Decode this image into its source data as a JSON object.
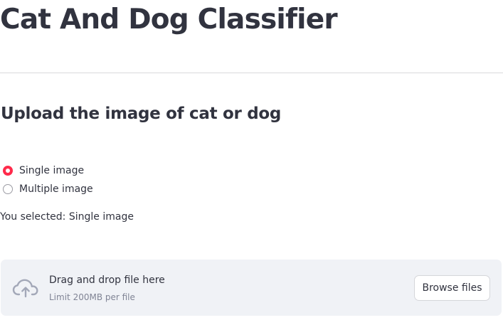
{
  "page": {
    "title": "Cat And Dog Classifier",
    "subtitle": "Upload the image of cat or dog"
  },
  "radio": {
    "options": [
      {
        "label": "Single image",
        "checked": true
      },
      {
        "label": "Multiple image",
        "checked": false
      }
    ],
    "selected_text": "You selected: Single image"
  },
  "uploader": {
    "icon": "cloud-upload-icon",
    "title": "Drag and drop file here",
    "limit": "Limit 200MB per file",
    "browse_label": "Browse files"
  },
  "colors": {
    "accent": "#ff2b4b",
    "text": "#31333f",
    "dropzone_bg": "#f0f2f6",
    "icon": "#a3a8b8"
  }
}
